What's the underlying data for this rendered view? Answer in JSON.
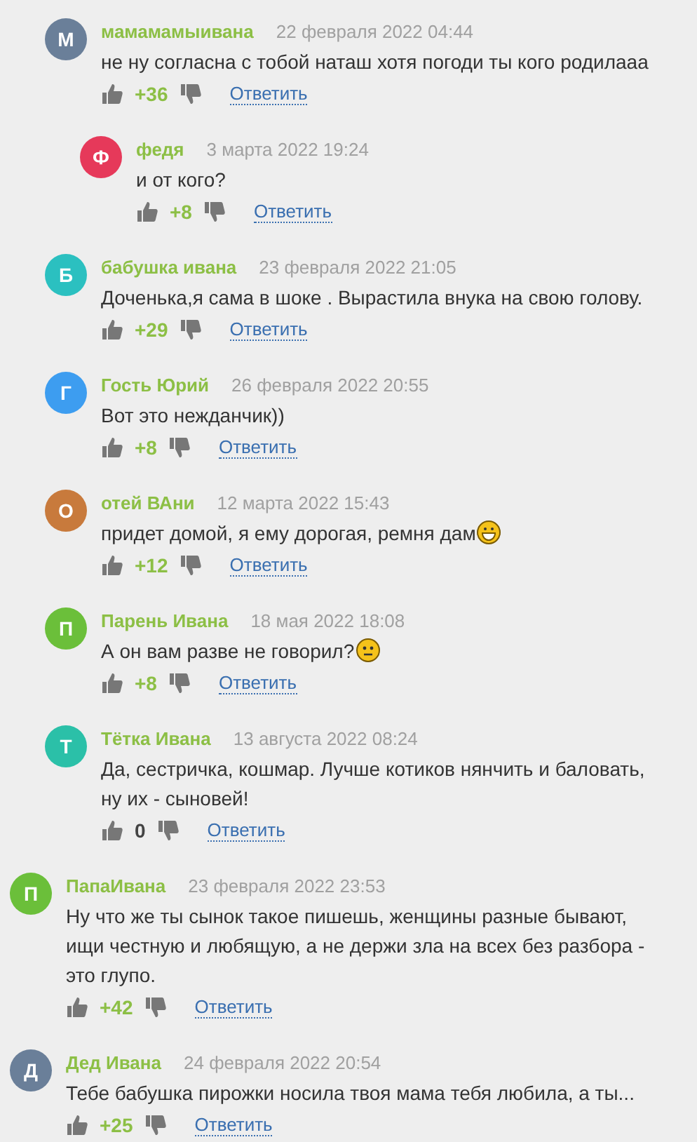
{
  "replies_to_hidden_comment": [
    {
      "author": "мамамамыивана",
      "avatar_letter": "М",
      "color": "#6a7f99",
      "date": "22 февраля 2022 04:44",
      "text": "не ну согласна с тобой наташ хотя погоди ты кого родилааа",
      "score": {
        "text": "+36",
        "kind": "positive"
      },
      "reply": "Ответить",
      "children": [
        {
          "author": "федя",
          "avatar_letter": "Ф",
          "color": "#e6395a",
          "date": "3 марта 2022 19:24",
          "text": "и от кого?",
          "score": {
            "text": "+8",
            "kind": "positive"
          },
          "reply": "Ответить"
        }
      ]
    },
    {
      "author": "бабушка ивана",
      "avatar_letter": "Б",
      "color": "#2bc0c0",
      "date": "23 февраля 2022 21:05",
      "text": "Доченька,я сама в шоке . Вырастила внука на свою голову.",
      "score": {
        "text": "+29",
        "kind": "positive"
      },
      "reply": "Ответить"
    },
    {
      "author": "Гость Юрий",
      "avatar_letter": "Г",
      "color": "#3d9df0",
      "date": "26 февраля 2022 20:55",
      "text": "Вот это нежданчик))",
      "score": {
        "text": "+8",
        "kind": "positive"
      },
      "reply": "Ответить"
    },
    {
      "author": "отей ВАни",
      "avatar_letter": "О",
      "color": "#c87a3c",
      "date": "12 марта 2022 15:43",
      "text": "придет домой, я ему дорогая, ремня дам",
      "emoji": {
        "kind": "grin"
      },
      "score": {
        "text": "+12",
        "kind": "positive"
      },
      "reply": "Ответить"
    },
    {
      "author": "Парень Ивана",
      "avatar_letter": "П",
      "color": "#6bbf3a",
      "date": "18 мая 2022 18:08",
      "text": "А он вам разве не говорил?",
      "emoji": {
        "kind": "neutral"
      },
      "score": {
        "text": "+8",
        "kind": "positive"
      },
      "reply": "Ответить"
    },
    {
      "author": "Тётка Ивана",
      "avatar_letter": "Т",
      "color": "#2bc0a8",
      "date": "13 августа 2022 08:24",
      "text": "Да, сестричка, кошмар. Лучше котиков нянчить и баловать, ну их - сыновей!",
      "score": {
        "text": "0",
        "kind": "neutral"
      },
      "reply": "Ответить"
    }
  ],
  "comments": [
    {
      "author": "ПапаИвана",
      "avatar_letter": "П",
      "color": "#6bbf3a",
      "date": "23 февраля 2022 23:53",
      "text": "Ну что же ты сынок такое пишешь, женщины разные бывают, ищи честную и любящую, а не держи зла на всех без разбора - это глупо.",
      "score": {
        "text": "+42",
        "kind": "positive"
      },
      "reply": "Ответить"
    },
    {
      "author": "Дед Ивана",
      "avatar_letter": "Д",
      "color": "#6a7f99",
      "date": "24 февраля 2022 20:54",
      "text": "Тебе бабушка пирожки носила твоя мама тебя любила, а ты...",
      "score": {
        "text": "+25",
        "kind": "positive"
      },
      "reply": "Ответить"
    }
  ]
}
